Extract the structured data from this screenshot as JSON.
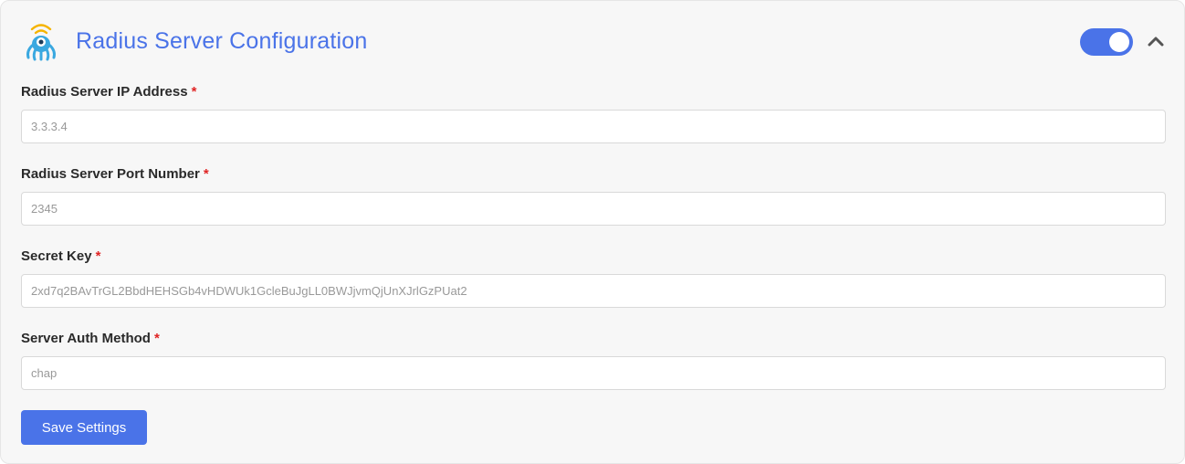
{
  "header": {
    "title": "Radius Server Configuration",
    "logo_icon": "octopus-signal-logo",
    "toggle_state": "on",
    "collapse_icon": "chevron-up-icon",
    "accent_color": "#4a73e8"
  },
  "fields": [
    {
      "label": "Radius Server IP Address",
      "required_mark": "*",
      "value": "3.3.3.4"
    },
    {
      "label": "Radius Server Port Number",
      "required_mark": "*",
      "value": "2345"
    },
    {
      "label": "Secret Key",
      "required_mark": "*",
      "value": "2xd7q2BAvTrGL2BbdHEHSGb4vHDWUk1GcleBuJgLL0BWJjvmQjUnXJrlGzPUat2"
    },
    {
      "label": "Server Auth Method",
      "required_mark": "*",
      "value": "chap"
    }
  ],
  "actions": {
    "save_label": "Save Settings"
  }
}
